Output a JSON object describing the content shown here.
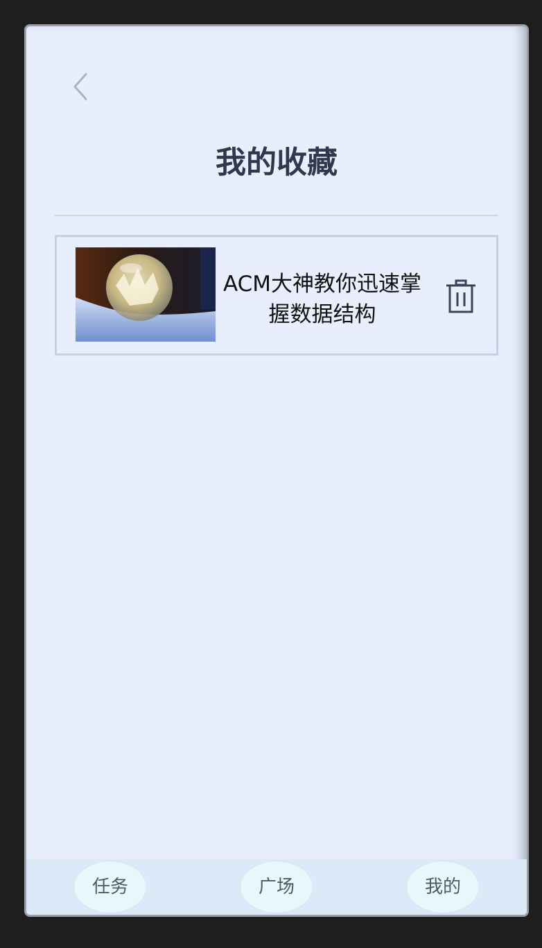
{
  "header": {
    "back_icon": "chevron-left-icon",
    "title": "我的收藏"
  },
  "favorites": [
    {
      "title": "ACM大神教你迅速掌握数据结构",
      "thumbnail": "frosted-bubble-on-snow-photo",
      "delete_icon": "trash-icon"
    }
  ],
  "tabbar": {
    "tabs": [
      "任务",
      "广场",
      "我的"
    ]
  },
  "colors": {
    "background": "#e8eefc",
    "title": "#2e3a4c",
    "card_border": "#c3d0e4",
    "tabbar": "#dce9f8",
    "tab_bubble": "#e7f8fb"
  }
}
